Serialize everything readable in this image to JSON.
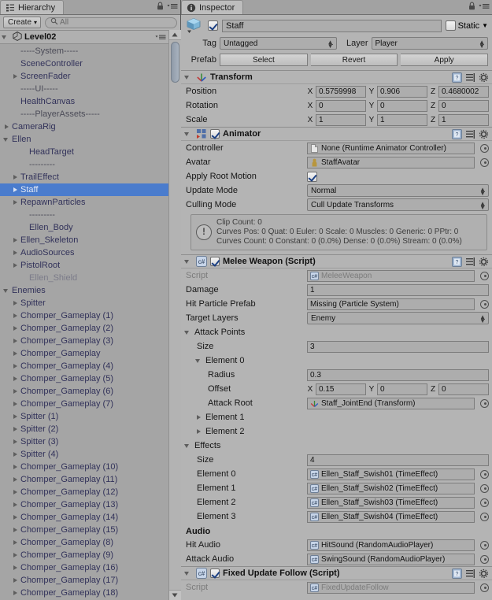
{
  "hierarchy": {
    "tab_label": "Hierarchy",
    "tab_icon": "hierarchy-icon",
    "create_button": "Create",
    "create_caret": "▾",
    "search_placeholder": "All",
    "search_value": "",
    "search_icon": "search-icon",
    "scene_name": "Level02",
    "scene_icon": "unity-scene-icon",
    "lock_icon": "lock-icon",
    "menu_icon": "options-menu-icon",
    "items": [
      {
        "label": "-----System-----",
        "indent": 1,
        "arrow": "none",
        "style": "sep"
      },
      {
        "label": "SceneController",
        "indent": 1,
        "arrow": "none",
        "style": "plain"
      },
      {
        "label": "ScreenFader",
        "indent": 1,
        "arrow": "right",
        "style": "plain"
      },
      {
        "label": "-----UI-----",
        "indent": 1,
        "arrow": "none",
        "style": "sep"
      },
      {
        "label": "HealthCanvas",
        "indent": 1,
        "arrow": "none",
        "style": "plain"
      },
      {
        "label": "-----PlayerAssets-----",
        "indent": 1,
        "arrow": "none",
        "style": "sep"
      },
      {
        "label": "CameraRig",
        "indent": 0,
        "arrow": "right",
        "style": "plain"
      },
      {
        "label": "Ellen",
        "indent": 0,
        "arrow": "down",
        "style": "plain"
      },
      {
        "label": "HeadTarget",
        "indent": 2,
        "arrow": "none",
        "style": "plain"
      },
      {
        "label": "---------",
        "indent": 2,
        "arrow": "none",
        "style": "sep"
      },
      {
        "label": "TrailEffect",
        "indent": 1,
        "arrow": "right",
        "style": "plain"
      },
      {
        "label": "Staff",
        "indent": 1,
        "arrow": "right",
        "style": "sel"
      },
      {
        "label": "RepawnParticles",
        "indent": 1,
        "arrow": "right",
        "style": "plain"
      },
      {
        "label": "---------",
        "indent": 2,
        "arrow": "none",
        "style": "sep"
      },
      {
        "label": "Ellen_Body",
        "indent": 2,
        "arrow": "none",
        "style": "plain"
      },
      {
        "label": "Ellen_Skeleton",
        "indent": 1,
        "arrow": "right",
        "style": "plain"
      },
      {
        "label": "AudioSources",
        "indent": 1,
        "arrow": "right",
        "style": "plain"
      },
      {
        "label": "PistolRoot",
        "indent": 1,
        "arrow": "right",
        "style": "plain"
      },
      {
        "label": "Ellen_Shield",
        "indent": 2,
        "arrow": "none",
        "style": "dim"
      },
      {
        "label": "Enemies",
        "indent": 0,
        "arrow": "down",
        "style": "plain"
      },
      {
        "label": "Spitter",
        "indent": 1,
        "arrow": "right",
        "style": "plain"
      },
      {
        "label": "Chomper_Gameplay (1)",
        "indent": 1,
        "arrow": "right",
        "style": "plain"
      },
      {
        "label": "Chomper_Gameplay (2)",
        "indent": 1,
        "arrow": "right",
        "style": "plain"
      },
      {
        "label": "Chomper_Gameplay (3)",
        "indent": 1,
        "arrow": "right",
        "style": "plain"
      },
      {
        "label": "Chomper_Gameplay",
        "indent": 1,
        "arrow": "right",
        "style": "plain"
      },
      {
        "label": "Chomper_Gameplay (4)",
        "indent": 1,
        "arrow": "right",
        "style": "plain"
      },
      {
        "label": "Chomper_Gameplay (5)",
        "indent": 1,
        "arrow": "right",
        "style": "plain"
      },
      {
        "label": "Chomper_Gameplay (6)",
        "indent": 1,
        "arrow": "right",
        "style": "plain"
      },
      {
        "label": "Chomper_Gameplay (7)",
        "indent": 1,
        "arrow": "right",
        "style": "plain"
      },
      {
        "label": "Spitter (1)",
        "indent": 1,
        "arrow": "right",
        "style": "plain"
      },
      {
        "label": "Spitter (2)",
        "indent": 1,
        "arrow": "right",
        "style": "plain"
      },
      {
        "label": "Spitter (3)",
        "indent": 1,
        "arrow": "right",
        "style": "plain"
      },
      {
        "label": "Spitter (4)",
        "indent": 1,
        "arrow": "right",
        "style": "plain"
      },
      {
        "label": "Chomper_Gameplay (10)",
        "indent": 1,
        "arrow": "right",
        "style": "plain"
      },
      {
        "label": "Chomper_Gameplay (11)",
        "indent": 1,
        "arrow": "right",
        "style": "plain"
      },
      {
        "label": "Chomper_Gameplay (12)",
        "indent": 1,
        "arrow": "right",
        "style": "plain"
      },
      {
        "label": "Chomper_Gameplay (13)",
        "indent": 1,
        "arrow": "right",
        "style": "plain"
      },
      {
        "label": "Chomper_Gameplay (14)",
        "indent": 1,
        "arrow": "right",
        "style": "plain"
      },
      {
        "label": "Chomper_Gameplay (15)",
        "indent": 1,
        "arrow": "right",
        "style": "plain"
      },
      {
        "label": "Chomper_Gameplay (8)",
        "indent": 1,
        "arrow": "right",
        "style": "plain"
      },
      {
        "label": "Chomper_Gameplay (9)",
        "indent": 1,
        "arrow": "right",
        "style": "plain"
      },
      {
        "label": "Chomper_Gameplay (16)",
        "indent": 1,
        "arrow": "right",
        "style": "plain"
      },
      {
        "label": "Chomper_Gameplay (17)",
        "indent": 1,
        "arrow": "right",
        "style": "plain"
      },
      {
        "label": "Chomper_Gameplay (18)",
        "indent": 1,
        "arrow": "right",
        "style": "plain"
      }
    ]
  },
  "inspector": {
    "tab_label": "Inspector",
    "tab_icon": "info-icon",
    "lock_icon": "lock-icon",
    "menu_icon": "options-menu-icon",
    "object": {
      "icon": "gameobject-cube-icon",
      "enabled": true,
      "name": "Staff",
      "static_label": "Static",
      "static_checked": false,
      "tag_label": "Tag",
      "tag_value": "Untagged",
      "layer_label": "Layer",
      "layer_value": "Player",
      "prefab_label": "Prefab",
      "prefab_buttons": [
        "Select",
        "Revert",
        "Apply"
      ]
    },
    "components": [
      {
        "name": "Transform",
        "icon": "transform-icon",
        "has_checkbox": false,
        "rows": [
          {
            "label": "Position",
            "type": "vec3",
            "x": "0.5759998",
            "y": "0.906",
            "z": "0.4680002"
          },
          {
            "label": "Rotation",
            "type": "vec3",
            "x": "0",
            "y": "0",
            "z": "0"
          },
          {
            "label": "Scale",
            "type": "vec3",
            "x": "1",
            "y": "1",
            "z": "1"
          }
        ]
      },
      {
        "name": "Animator",
        "icon": "animator-icon",
        "has_checkbox": true,
        "checked": true,
        "rows": [
          {
            "label": "Controller",
            "type": "object",
            "value": "None (Runtime Animator Controller)",
            "icon": "asset-icon"
          },
          {
            "label": "Avatar",
            "type": "object",
            "value": "StaffAvatar",
            "icon": "avatar-icon"
          },
          {
            "label": "Apply Root Motion",
            "type": "checkbox",
            "checked": true
          },
          {
            "label": "Update Mode",
            "type": "dropdown",
            "value": "Normal"
          },
          {
            "label": "Culling Mode",
            "type": "dropdown",
            "value": "Cull Update Transforms"
          }
        ],
        "info_box": {
          "icon": "warning-icon",
          "lines": [
            "Clip Count: 0",
            "Curves Pos: 0 Quat: 0 Euler: 0 Scale: 0 Muscles: 0 Generic: 0 PPtr: 0",
            "Curves Count: 0 Constant: 0 (0.0%) Dense: 0 (0.0%) Stream: 0 (0.0%)"
          ]
        }
      },
      {
        "name": "Melee Weapon (Script)",
        "icon": "csharp-script-icon",
        "has_checkbox": true,
        "checked": true,
        "rows": [
          {
            "label": "Script",
            "type": "object",
            "value": "MeleeWeapon",
            "icon": "csharp-script-icon",
            "disabled": true
          },
          {
            "label": "Damage",
            "type": "text",
            "value": "1"
          },
          {
            "label": "Hit Particle Prefab",
            "type": "object",
            "value": "Missing (Particle System)"
          },
          {
            "label": "Target Layers",
            "type": "dropdown",
            "value": "Enemy"
          },
          {
            "label": "Attack Points",
            "type": "foldout",
            "expanded": true,
            "indent": 0
          },
          {
            "label": "Size",
            "type": "text",
            "value": "3",
            "indent": 1
          },
          {
            "label": "Element 0",
            "type": "foldout",
            "expanded": true,
            "indent": 1
          },
          {
            "label": "Radius",
            "type": "text",
            "value": "0.3",
            "indent": 2
          },
          {
            "label": "Offset",
            "type": "vec3",
            "x": "0.15",
            "y": "0",
            "z": "0",
            "indent": 2
          },
          {
            "label": "Attack Root",
            "type": "object",
            "value": "Staff_JointEnd (Transform)",
            "icon": "transform-icon",
            "indent": 2
          },
          {
            "label": "Element 1",
            "type": "foldout",
            "expanded": false,
            "indent": 1
          },
          {
            "label": "Element 2",
            "type": "foldout",
            "expanded": false,
            "indent": 1
          },
          {
            "label": "Effects",
            "type": "foldout",
            "expanded": true,
            "indent": 0
          },
          {
            "label": "Size",
            "type": "text",
            "value": "4",
            "indent": 1
          },
          {
            "label": "Element 0",
            "type": "object",
            "value": "Ellen_Staff_Swish01 (TimeEffect)",
            "icon": "csharp-script-icon",
            "indent": 1
          },
          {
            "label": "Element 1",
            "type": "object",
            "value": "Ellen_Staff_Swish02 (TimeEffect)",
            "icon": "csharp-script-icon",
            "indent": 1
          },
          {
            "label": "Element 2",
            "type": "object",
            "value": "Ellen_Staff_Swish03 (TimeEffect)",
            "icon": "csharp-script-icon",
            "indent": 1
          },
          {
            "label": "Element 3",
            "type": "object",
            "value": "Ellen_Staff_Swish04 (TimeEffect)",
            "icon": "csharp-script-icon",
            "indent": 1
          },
          {
            "label": "Audio",
            "type": "header"
          },
          {
            "label": "Hit Audio",
            "type": "object",
            "value": "HitSound (RandomAudioPlayer)",
            "icon": "csharp-script-icon"
          },
          {
            "label": "Attack Audio",
            "type": "object",
            "value": "SwingSound (RandomAudioPlayer)",
            "icon": "csharp-script-icon"
          }
        ]
      },
      {
        "name": "Fixed Update Follow (Script)",
        "icon": "csharp-script-icon",
        "has_checkbox": true,
        "checked": true,
        "rows": [
          {
            "label": "Script",
            "type": "object",
            "value": "FixedUpdateFollow",
            "icon": "csharp-script-icon",
            "disabled": true
          }
        ]
      }
    ]
  },
  "colors": {
    "selection_blue": "#4a7ccd",
    "panel_bg": "#b4b4b4",
    "tree_bg": "#a5a5a5",
    "tree_text": "#32325a"
  }
}
